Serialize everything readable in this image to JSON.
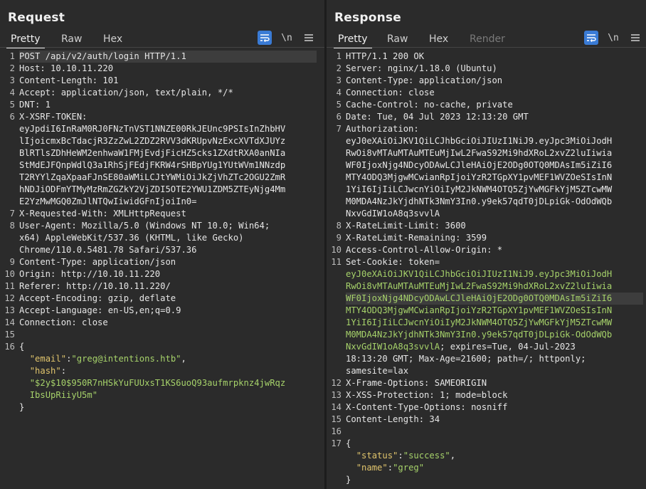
{
  "layout_toggle": {
    "side_by_side": "layout-columns-icon",
    "stacked": "layout-rows-icon",
    "single": "layout-single-icon"
  },
  "request": {
    "title": "Request",
    "tabs": [
      "Pretty",
      "Raw",
      "Hex"
    ],
    "lines": [
      {
        "n": "1",
        "t": "POST /api/v2/auth/login HTTP/1.1"
      },
      {
        "n": "2",
        "t": "Host: 10.10.11.220"
      },
      {
        "n": "3",
        "t": "Content-Length: 101"
      },
      {
        "n": "4",
        "t": "Accept: application/json, text/plain, */*"
      },
      {
        "n": "5",
        "t": "DNT: 1"
      },
      {
        "n": "6",
        "t": "X-XSRF-TOKEN:"
      },
      {
        "n": "",
        "t": "eyJpdiI6InRaM0RJ0FNzTnVST1NNZE00RkJEUnc9PSIsInZhbHV"
      },
      {
        "n": "",
        "t": "lIjoicmxBcTdacjR3ZzZwL2ZDZ2RVV3dKRUpvNzExcXVTdXJUYz"
      },
      {
        "n": "",
        "t": "BlRTlsZDhHeWM2enhwaW1FMjEvdjFicHZ5cks1ZXdtRXA0anNIa"
      },
      {
        "n": "",
        "t": "StMdEJFQnpWdlQ3a1RhSjFEdjFKRW4rSHBpYUg1YUtWVm1NNzdp"
      },
      {
        "n": "",
        "t": "T2RYYlZqaXpaaFJnSE80aWMiLCJtYWMiOiJkZjVhZTc2OGU2ZmR"
      },
      {
        "n": "",
        "t": "hNDJiODFmYTMyMzRmZGZkY2VjZDI5OTE2YWU1ZDM5ZTEyNjg4Mm"
      },
      {
        "n": "",
        "t": "E2YzMwMGQ0ZmJlNTQwIiwidGFnIjoiIn0="
      },
      {
        "n": "7",
        "t": "X-Requested-With: XMLHttpRequest"
      },
      {
        "n": "8",
        "t": "User-Agent: Mozilla/5.0 (Windows NT 10.0; Win64;"
      },
      {
        "n": "",
        "t": "x64) AppleWebKit/537.36 (KHTML, like Gecko)"
      },
      {
        "n": "",
        "t": "Chrome/110.0.5481.78 Safari/537.36"
      },
      {
        "n": "9",
        "t": "Content-Type: application/json"
      },
      {
        "n": "10",
        "t": "Origin: http://10.10.11.220"
      },
      {
        "n": "11",
        "t": "Referer: http://10.10.11.220/"
      },
      {
        "n": "12",
        "t": "Accept-Encoding: gzip, deflate"
      },
      {
        "n": "13",
        "t": "Accept-Language: en-US,en;q=0.9"
      },
      {
        "n": "14",
        "t": "Connection: close"
      },
      {
        "n": "15",
        "t": ""
      },
      {
        "n": "16",
        "t": "{"
      }
    ],
    "json_body": {
      "email_key": "\"email\"",
      "email_val": "\"greg@intentions.htb\"",
      "hash_key": "\"hash\"",
      "hash_val_1": "\"$2y$10$950R7nHSkYuFUUxsT1KS6uoQ93aufmrpknz4jwRqz",
      "hash_val_2": "IbsUpRiiyU5m\"",
      "close": "}"
    }
  },
  "response": {
    "title": "Response",
    "tabs": [
      "Pretty",
      "Raw",
      "Hex",
      "Render"
    ],
    "lines": [
      {
        "n": "1",
        "t": "HTTP/1.1 200 OK"
      },
      {
        "n": "2",
        "t": "Server: nginx/1.18.0 (Ubuntu)"
      },
      {
        "n": "3",
        "t": "Content-Type: application/json"
      },
      {
        "n": "4",
        "t": "Connection: close"
      },
      {
        "n": "5",
        "t": "Cache-Control: no-cache, private"
      },
      {
        "n": "6",
        "t": "Date: Tue, 04 Jul 2023 12:13:20 GMT"
      },
      {
        "n": "7",
        "t": "Authorization:"
      },
      {
        "n": "",
        "t": "eyJ0eXAiOiJKV1QiLCJhbGciOiJIUzI1NiJ9.eyJpc3MiOiJodH"
      },
      {
        "n": "",
        "t": "RwOi8vMTAuMTAuMTEuMjIwL2FwaS92Mi9hdXRoL2xvZ2luIiwia"
      },
      {
        "n": "",
        "t": "WF0IjoxNjg4NDcyODAwLCJleHAiOjE2ODg0OTQ0MDAsIm5iZiI6"
      },
      {
        "n": "",
        "t": "MTY4ODQ3MjgwMCwianRpIjoiYzR2TGpXY1pvMEF1WVZOeSIsInN"
      },
      {
        "n": "",
        "t": "1YiI6IjIiLCJwcnYiOiIyM2JkNWM4OTQ5ZjYwMGFkYjM5ZTcwMW"
      },
      {
        "n": "",
        "t": "M0MDA4NzJkYjdhNTk3NmY3In0.y9ek57qdT0jDLpiGk-OdOdWQb"
      },
      {
        "n": "",
        "t": "NxvGdIW1oA8q3svvlA"
      },
      {
        "n": "8",
        "t": "X-RateLimit-Limit: 3600"
      },
      {
        "n": "9",
        "t": "X-RateLimit-Remaining: 3599"
      },
      {
        "n": "10",
        "t": "Access-Control-Allow-Origin: *"
      },
      {
        "n": "11",
        "t": "Set-Cookie: token="
      }
    ],
    "cookie_lines": [
      "eyJ0eXAiOiJKV1QiLCJhbGciOiJIUzI1NiJ9.eyJpc3MiOiJodH",
      "RwOi8vMTAuMTAuMTEuMjIwL2FwaS92Mi9hdXRoL2xvZ2luIiwia",
      "WF0IjoxNjg4NDcyODAwLCJleHAiOjE2ODg0OTQ0MDAsIm5iZiI6",
      "MTY4ODQ3MjgwMCwianRpIjoiYzR2TGpXY1pvMEF1WVZOeSIsInN",
      "1YiI6IjIiLCJwcnYiOiIyM2JkNWM4OTQ5ZjYwMGFkYjM5ZTcwMW",
      "M0MDA4NzJkYjdhNTk3NmY3In0.y9ek57qdT0jDLpiGk-OdOdWQb",
      "NxvGdIW1oA8q3svvlA"
    ],
    "cookie_tail_1": "; expires=Tue, 04-Jul-2023",
    "cookie_tail_2": "18:13:20 GMT; Max-Age=21600; path=/; httponly;",
    "cookie_tail_3": "samesite=lax",
    "lines2": [
      {
        "n": "12",
        "t": "X-Frame-Options: SAMEORIGIN"
      },
      {
        "n": "13",
        "t": "X-XSS-Protection: 1; mode=block"
      },
      {
        "n": "14",
        "t": "X-Content-Type-Options: nosniff"
      },
      {
        "n": "15",
        "t": "Content-Length: 34"
      },
      {
        "n": "16",
        "t": ""
      },
      {
        "n": "17",
        "t": "{"
      }
    ],
    "json_body": {
      "status_key": "\"status\"",
      "status_val": "\"success\"",
      "name_key": "\"name\"",
      "name_val": "\"greg\"",
      "close": "}"
    }
  },
  "toolbar": {
    "wrap_icon": "word-wrap-icon",
    "newline_label": "\\n",
    "menu_icon": "hamburger-menu-icon"
  }
}
